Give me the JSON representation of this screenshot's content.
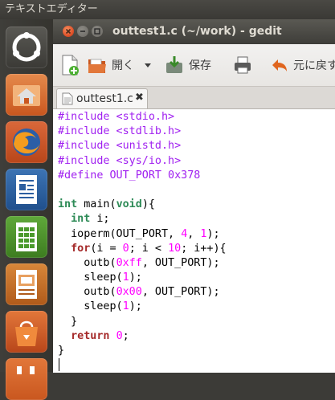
{
  "top_panel": {
    "app_name": "テキストエディター"
  },
  "launcher": {
    "items": [
      {
        "name": "dash-home"
      },
      {
        "name": "home-folder"
      },
      {
        "name": "firefox"
      },
      {
        "name": "libreoffice-writer"
      },
      {
        "name": "libreoffice-calc"
      },
      {
        "name": "libreoffice-impress"
      },
      {
        "name": "ubuntu-software-center"
      },
      {
        "name": "ubuntu-one"
      }
    ]
  },
  "window": {
    "title": "outtest1.c (~/work) - gedit",
    "toolbar": {
      "open_label": "開く",
      "save_label": "保存",
      "undo_label": "元に戻す"
    },
    "tab": {
      "label": "outtest1.c"
    },
    "code_lines": [
      [
        {
          "t": "#include <stdio.h>",
          "c": "pp"
        }
      ],
      [
        {
          "t": "#include <stdlib.h>",
          "c": "pp"
        }
      ],
      [
        {
          "t": "#include <unistd.h>",
          "c": "pp"
        }
      ],
      [
        {
          "t": "#include <sys/io.h>",
          "c": "pp"
        }
      ],
      [
        {
          "t": "#define OUT_PORT 0x378",
          "c": "pp"
        }
      ],
      [],
      [
        {
          "t": "int",
          "c": "ty"
        },
        {
          "t": " main("
        },
        {
          "t": "void",
          "c": "ty"
        },
        {
          "t": "){"
        }
      ],
      [
        {
          "t": "  "
        },
        {
          "t": "int",
          "c": "ty"
        },
        {
          "t": " i;"
        }
      ],
      [
        {
          "t": "  ioperm(OUT_PORT, "
        },
        {
          "t": "4",
          "c": "num"
        },
        {
          "t": ", "
        },
        {
          "t": "1",
          "c": "num"
        },
        {
          "t": ");"
        }
      ],
      [
        {
          "t": "  "
        },
        {
          "t": "for",
          "c": "kw"
        },
        {
          "t": "(i = "
        },
        {
          "t": "0",
          "c": "num"
        },
        {
          "t": "; i < "
        },
        {
          "t": "10",
          "c": "num"
        },
        {
          "t": "; i++){"
        }
      ],
      [
        {
          "t": "    outb("
        },
        {
          "t": "0xff",
          "c": "num"
        },
        {
          "t": ", OUT_PORT);"
        }
      ],
      [
        {
          "t": "    sleep("
        },
        {
          "t": "1",
          "c": "num"
        },
        {
          "t": ");"
        }
      ],
      [
        {
          "t": "    outb("
        },
        {
          "t": "0x00",
          "c": "num"
        },
        {
          "t": ", OUT_PORT);"
        }
      ],
      [
        {
          "t": "    sleep("
        },
        {
          "t": "1",
          "c": "num"
        },
        {
          "t": ");"
        }
      ],
      [
        {
          "t": "  }"
        }
      ],
      [
        {
          "t": "  "
        },
        {
          "t": "return",
          "c": "kw"
        },
        {
          "t": " "
        },
        {
          "t": "0",
          "c": "num"
        },
        {
          "t": ";"
        }
      ],
      [
        {
          "t": "}"
        }
      ]
    ]
  },
  "colors": {
    "preprocessor": "#a020f0",
    "keyword": "#a52a2a",
    "type": "#2e8b57",
    "number": "#ff00ff"
  }
}
